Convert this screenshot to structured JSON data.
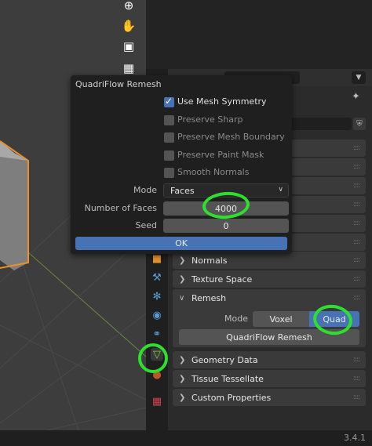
{
  "viewport": {
    "tools": [
      {
        "name": "zoom-icon",
        "glyph": "⊕"
      },
      {
        "name": "pan-hand-icon",
        "glyph": "✋"
      },
      {
        "name": "camera-icon",
        "glyph": "▣"
      },
      {
        "name": "grid-icon",
        "glyph": "▦"
      }
    ]
  },
  "dialog": {
    "title": "QuadriFlow Remesh",
    "options": [
      {
        "label": "Use Mesh Symmetry",
        "checked": true,
        "enabled": true
      },
      {
        "label": "Preserve Sharp",
        "checked": false,
        "enabled": false
      },
      {
        "label": "Preserve Mesh Boundary",
        "checked": false,
        "enabled": false
      },
      {
        "label": "Preserve Paint Mask",
        "checked": false,
        "enabled": false
      },
      {
        "label": "Smooth Normals",
        "checked": false,
        "enabled": false
      }
    ],
    "mode_label": "Mode",
    "mode_value": "Faces",
    "num_faces_label": "Number of Faces",
    "num_faces_value": "4000",
    "seed_label": "Seed",
    "seed_value": "0",
    "ok_label": "OK"
  },
  "properties": {
    "panels_before": [
      "Normals",
      "Texture Space"
    ],
    "remesh": {
      "title": "Remesh",
      "mode_label": "Mode",
      "modes": [
        "Voxel",
        "Quad"
      ],
      "active_mode": "Quad",
      "quadriflow_button": "QuadriFlow Remesh"
    },
    "panels_after": [
      "Geometry Data",
      "Tissue Tessellate",
      "Custom Properties"
    ]
  },
  "status": {
    "version": "3.4.1"
  },
  "colors": {
    "accent": "#4772b3",
    "annotation": "#2ee02e",
    "object_outline": "#e8902a"
  }
}
